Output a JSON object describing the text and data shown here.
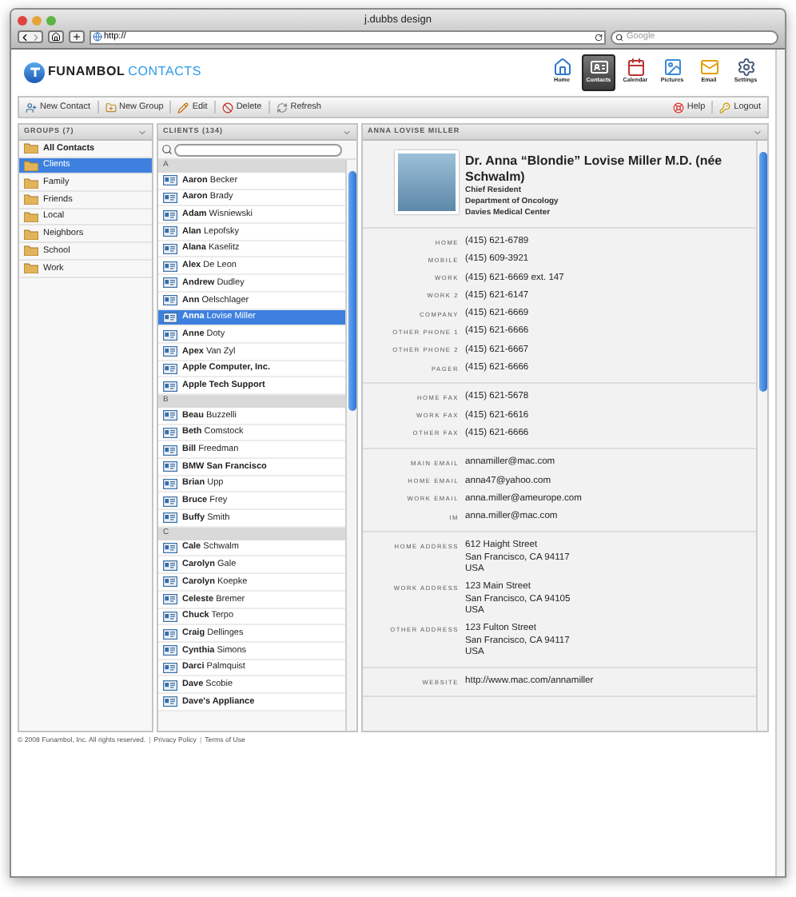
{
  "browser": {
    "title": "j.dubbs design",
    "address": "http://",
    "search_placeholder": "Google"
  },
  "app": {
    "logo": {
      "brand": "FUNAMBOL",
      "product": "CONTACTS"
    },
    "nav": [
      {
        "kind": "home",
        "label": "Home",
        "selected": false
      },
      {
        "kind": "contacts",
        "label": "Contacts",
        "selected": true
      },
      {
        "kind": "calendar",
        "label": "Calendar",
        "selected": false
      },
      {
        "kind": "pictures",
        "label": "Pictures",
        "selected": false
      },
      {
        "kind": "email",
        "label": "Email",
        "selected": false
      },
      {
        "kind": "settings",
        "label": "Settings",
        "selected": false
      }
    ],
    "toolbar_left": [
      {
        "kind": "new-contact",
        "label": "New Contact"
      },
      {
        "kind": "new-group",
        "label": "New Group"
      },
      {
        "kind": "edit",
        "label": "Edit"
      },
      {
        "kind": "delete",
        "label": "Delete"
      },
      {
        "kind": "refresh",
        "label": "Refresh"
      }
    ],
    "toolbar_right": [
      {
        "kind": "help",
        "label": "Help"
      },
      {
        "kind": "logout",
        "label": "Logout"
      }
    ]
  },
  "groups": {
    "title": "GROUPS (7)",
    "items": [
      {
        "kind": "all",
        "label": "All Contacts",
        "selected": false
      },
      {
        "kind": "group",
        "label": "Clients",
        "selected": true
      },
      {
        "kind": "group",
        "label": "Family",
        "selected": false
      },
      {
        "kind": "group",
        "label": "Friends",
        "selected": false
      },
      {
        "kind": "group",
        "label": "Local",
        "selected": false
      },
      {
        "kind": "group",
        "label": "Neighbors",
        "selected": false
      },
      {
        "kind": "group",
        "label": "School",
        "selected": false
      },
      {
        "kind": "group",
        "label": "Work",
        "selected": false
      }
    ]
  },
  "clients": {
    "title": "CLIENTS (134)",
    "sections": [
      {
        "letter": "A",
        "contacts": [
          {
            "kind": "person",
            "name": "**Aaron** Becker",
            "selected": false
          },
          {
            "kind": "person",
            "name": "**Aaron** Brady",
            "selected": false
          },
          {
            "kind": "person",
            "name": "**Adam** Wisniewski",
            "selected": false
          },
          {
            "kind": "person",
            "name": "**Alan** Lepofsky",
            "selected": false
          },
          {
            "kind": "person",
            "name": "**Alana** Kaselitz",
            "selected": false
          },
          {
            "kind": "person",
            "name": "**Alex** De Leon",
            "selected": false
          },
          {
            "kind": "person",
            "name": "**Andrew** Dudley",
            "selected": false
          },
          {
            "kind": "person",
            "name": "**Ann** Oelschlager",
            "selected": false
          },
          {
            "kind": "person",
            "name": "**Anna** Lovise Miller",
            "selected": true
          },
          {
            "kind": "person",
            "name": "**Anne** Doty",
            "selected": false
          },
          {
            "kind": "person",
            "name": "**Apex** Van Zyl",
            "selected": false
          },
          {
            "kind": "company",
            "name": "Apple Computer, Inc.",
            "selected": false
          },
          {
            "kind": "company",
            "name": "Apple Tech Support",
            "selected": false
          }
        ]
      },
      {
        "letter": "B",
        "contacts": [
          {
            "kind": "person",
            "name": "**Beau** Buzzelli",
            "selected": false
          },
          {
            "kind": "person",
            "name": "**Beth** Comstock",
            "selected": false
          },
          {
            "kind": "person",
            "name": "**Bill** Freedman",
            "selected": false
          },
          {
            "kind": "company",
            "name": "BMW San Francisco",
            "selected": false
          },
          {
            "kind": "person",
            "name": "**Brian** Upp",
            "selected": false
          },
          {
            "kind": "person",
            "name": "**Bruce** Frey",
            "selected": false
          },
          {
            "kind": "person",
            "name": "**Buffy** Smith",
            "selected": false
          }
        ]
      },
      {
        "letter": "C",
        "contacts": [
          {
            "kind": "person",
            "name": "**Cale** Schwalm",
            "selected": false
          },
          {
            "kind": "person",
            "name": "**Carolyn** Gale",
            "selected": false
          },
          {
            "kind": "person",
            "name": "**Carolyn** Koepke",
            "selected": false
          },
          {
            "kind": "person",
            "name": "**Celeste** Bremer",
            "selected": false
          },
          {
            "kind": "person",
            "name": "**Chuck** Terpo",
            "selected": false
          },
          {
            "kind": "person",
            "name": "**Craig** Dellinges",
            "selected": false
          },
          {
            "kind": "person",
            "name": "**Cynthia** Simons",
            "selected": false
          },
          {
            "kind": "person",
            "name": "**Darci** Palmquist",
            "selected": false
          },
          {
            "kind": "person",
            "name": "**Dave** Scobie",
            "selected": false
          },
          {
            "kind": "company",
            "name": "Dave's Appliance",
            "selected": false
          }
        ]
      }
    ]
  },
  "detail": {
    "title": "ANNA LOVISE MILLER",
    "name": "Dr. Anna “Blondie” Lovise Miller M.D. (née Schwalm)",
    "lines": [
      "Chief Resident",
      "Department of Oncology",
      "Davies Medical Center"
    ],
    "sections": [
      {
        "fields": [
          {
            "label": "HOME",
            "value": [
              "(415) 621-6789"
            ]
          },
          {
            "label": "MOBILE",
            "value": [
              "(415) 609-3921"
            ]
          },
          {
            "label": "WORK",
            "value": [
              "(415) 621-6669 ext. 147"
            ]
          },
          {
            "label": "WORK 2",
            "value": [
              "(415) 621-6147"
            ]
          },
          {
            "label": "COMPANY",
            "value": [
              "(415) 621-6669"
            ]
          },
          {
            "label": "OTHER PHONE 1",
            "value": [
              "(415) 621-6666"
            ]
          },
          {
            "label": "OTHER PHONE 2",
            "value": [
              "(415) 621-6667"
            ]
          },
          {
            "label": "PAGER",
            "value": [
              "(415) 621-6666"
            ]
          }
        ]
      },
      {
        "fields": [
          {
            "label": "HOME FAX",
            "value": [
              "(415) 621-5678"
            ]
          },
          {
            "label": "WORK FAX",
            "value": [
              "(415) 621-6616"
            ]
          },
          {
            "label": "OTHER FAX",
            "value": [
              "(415) 621-6666"
            ]
          }
        ]
      },
      {
        "fields": [
          {
            "label": "MAIN EMAIL",
            "value": [
              "annamiller@mac.com"
            ]
          },
          {
            "label": "HOME EMAIL",
            "value": [
              "anna47@yahoo.com"
            ]
          },
          {
            "label": "WORK EMAIL",
            "value": [
              "anna.miller@ameurope.com"
            ]
          },
          {
            "label": "IM",
            "value": [
              "anna.miller@mac.com"
            ]
          }
        ]
      },
      {
        "fields": [
          {
            "label": "HOME ADDRESS",
            "value": [
              "612 Haight Street",
              "San Francisco, CA 94117",
              "USA"
            ]
          },
          {
            "label": "WORK ADDRESS",
            "value": [
              "123 Main Street",
              "San Francisco, CA 94105",
              "USA"
            ]
          },
          {
            "label": "OTHER ADDRESS",
            "value": [
              "123 Fulton Street",
              "San Francisco, CA 94117",
              "USA"
            ]
          }
        ]
      },
      {
        "fields": [
          {
            "label": "WEBSITE",
            "value": [
              "http://www.mac.com/annamiller"
            ]
          }
        ]
      }
    ]
  },
  "footer": {
    "items": [
      {
        "kind": "text",
        "text": "© 2008 Funambol, Inc. All rights reserved."
      },
      {
        "kind": "separator",
        "text": "|"
      },
      {
        "kind": "link",
        "text": "Privacy Policy"
      },
      {
        "kind": "separator",
        "text": "|"
      },
      {
        "kind": "link",
        "text": "Terms of Use"
      }
    ]
  }
}
